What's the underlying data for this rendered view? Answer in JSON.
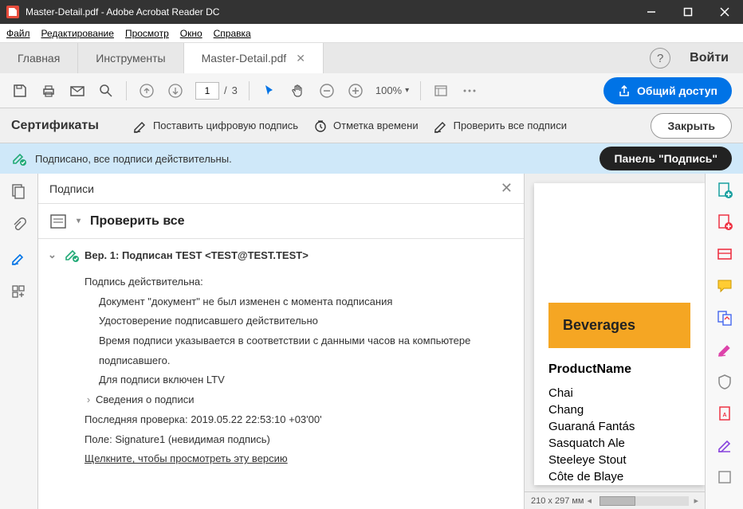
{
  "titlebar": {
    "title": "Master-Detail.pdf - Adobe Acrobat Reader DC"
  },
  "menu": {
    "file": "Файл",
    "edit": "Редактирование",
    "view": "Просмотр",
    "window": "Окно",
    "help": "Справка"
  },
  "tabs": {
    "home": "Главная",
    "tools": "Инструменты",
    "doc": "Master-Detail.pdf",
    "login": "Войти"
  },
  "toolbar": {
    "page_current": "1",
    "page_sep": "/",
    "page_total": "3",
    "zoom": "100%",
    "share": "Общий доступ"
  },
  "certbar": {
    "title": "Сертификаты",
    "sign": "Поставить цифровую подпись",
    "timestamp": "Отметка времени",
    "verify_all": "Проверить все подписи",
    "close": "Закрыть"
  },
  "banner": {
    "text": "Подписано, все подписи действительны.",
    "panel": "Панель \"Подпись\""
  },
  "sigpanel": {
    "header": "Подписи",
    "verify": "Проверить все",
    "ver_title": "Вер. 1: Подписан TEST <TEST@TEST.TEST>",
    "valid": "Подпись действительна:",
    "l1": "Документ \"документ\" не был изменен с момента подписания",
    "l2": "Удостоверение подписавшего действительно",
    "l3": "Время подписи указывается в соответствии с данными часов на компьютере подписавшего.",
    "l4": "Для подписи включен LTV",
    "details": "Сведения о подписи",
    "last_check": "Последняя проверка: 2019.05.22 22:53:10 +03'00'",
    "field": "Поле: Signature1 (невидимая подпись)",
    "view_version": "Щелкните, чтобы просмотреть эту версию"
  },
  "doc": {
    "category": "Beverages",
    "col": "ProductName",
    "rows": [
      "Chai",
      "Chang",
      "Guaraná Fantás",
      "Sasquatch Ale",
      "Steeleye Stout",
      "Côte de Blaye"
    ],
    "dims": "210 x 297 мм"
  }
}
